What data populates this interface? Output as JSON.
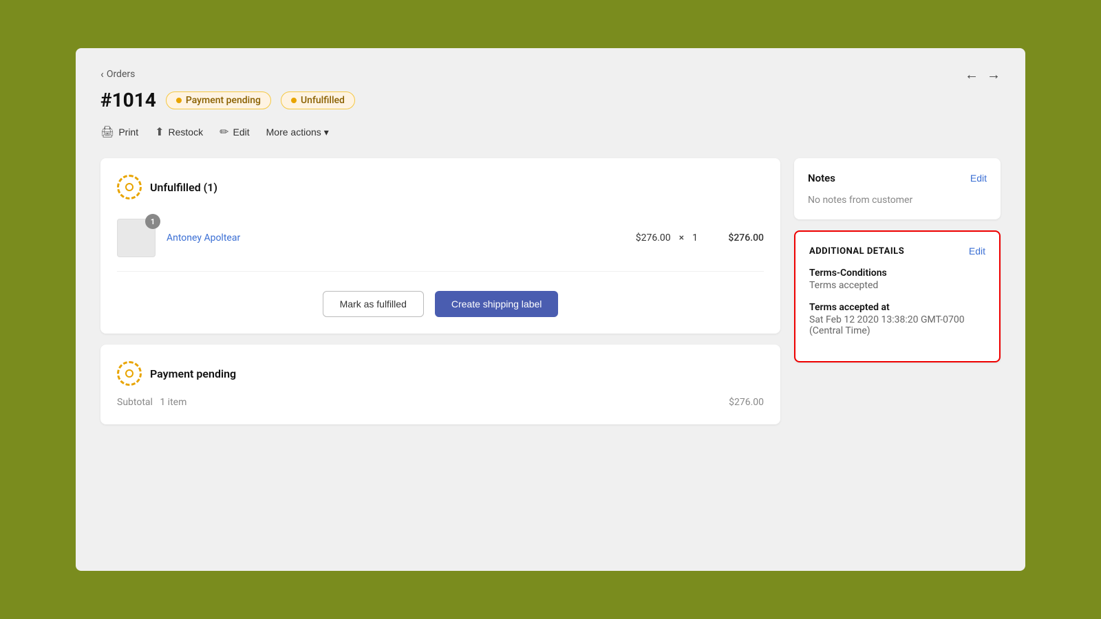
{
  "navigation": {
    "back_label": "Orders",
    "order_number": "#1014",
    "prev_arrow": "←",
    "next_arrow": "→"
  },
  "badges": {
    "payment_status": "Payment pending",
    "fulfillment_status": "Unfulfilled"
  },
  "toolbar": {
    "print_label": "Print",
    "restock_label": "Restock",
    "edit_label": "Edit",
    "more_actions_label": "More actions"
  },
  "unfulfilled_section": {
    "title": "Unfulfilled (1)",
    "product": {
      "name": "Antoney Apoltear",
      "unit_price": "$276.00",
      "multiply": "×",
      "quantity": "1",
      "total": "$276.00",
      "badge_count": "1"
    },
    "mark_fulfilled_label": "Mark as fulfilled",
    "create_shipping_label": "Create shipping label"
  },
  "payment_section": {
    "title": "Payment pending",
    "subtotal_label": "Subtotal",
    "subtotal_items": "1 item",
    "subtotal_value": "$276.00"
  },
  "notes_section": {
    "title": "Notes",
    "edit_label": "Edit",
    "empty_text": "No notes from customer"
  },
  "additional_details": {
    "title": "ADDITIONAL DETAILS",
    "edit_label": "Edit",
    "terms_label": "Terms-Conditions",
    "terms_value": "Terms accepted",
    "terms_accepted_at_label": "Terms accepted at",
    "terms_accepted_at_value": "Sat Feb 12 2020 13:38:20 GMT-0700 (Central Time)"
  }
}
